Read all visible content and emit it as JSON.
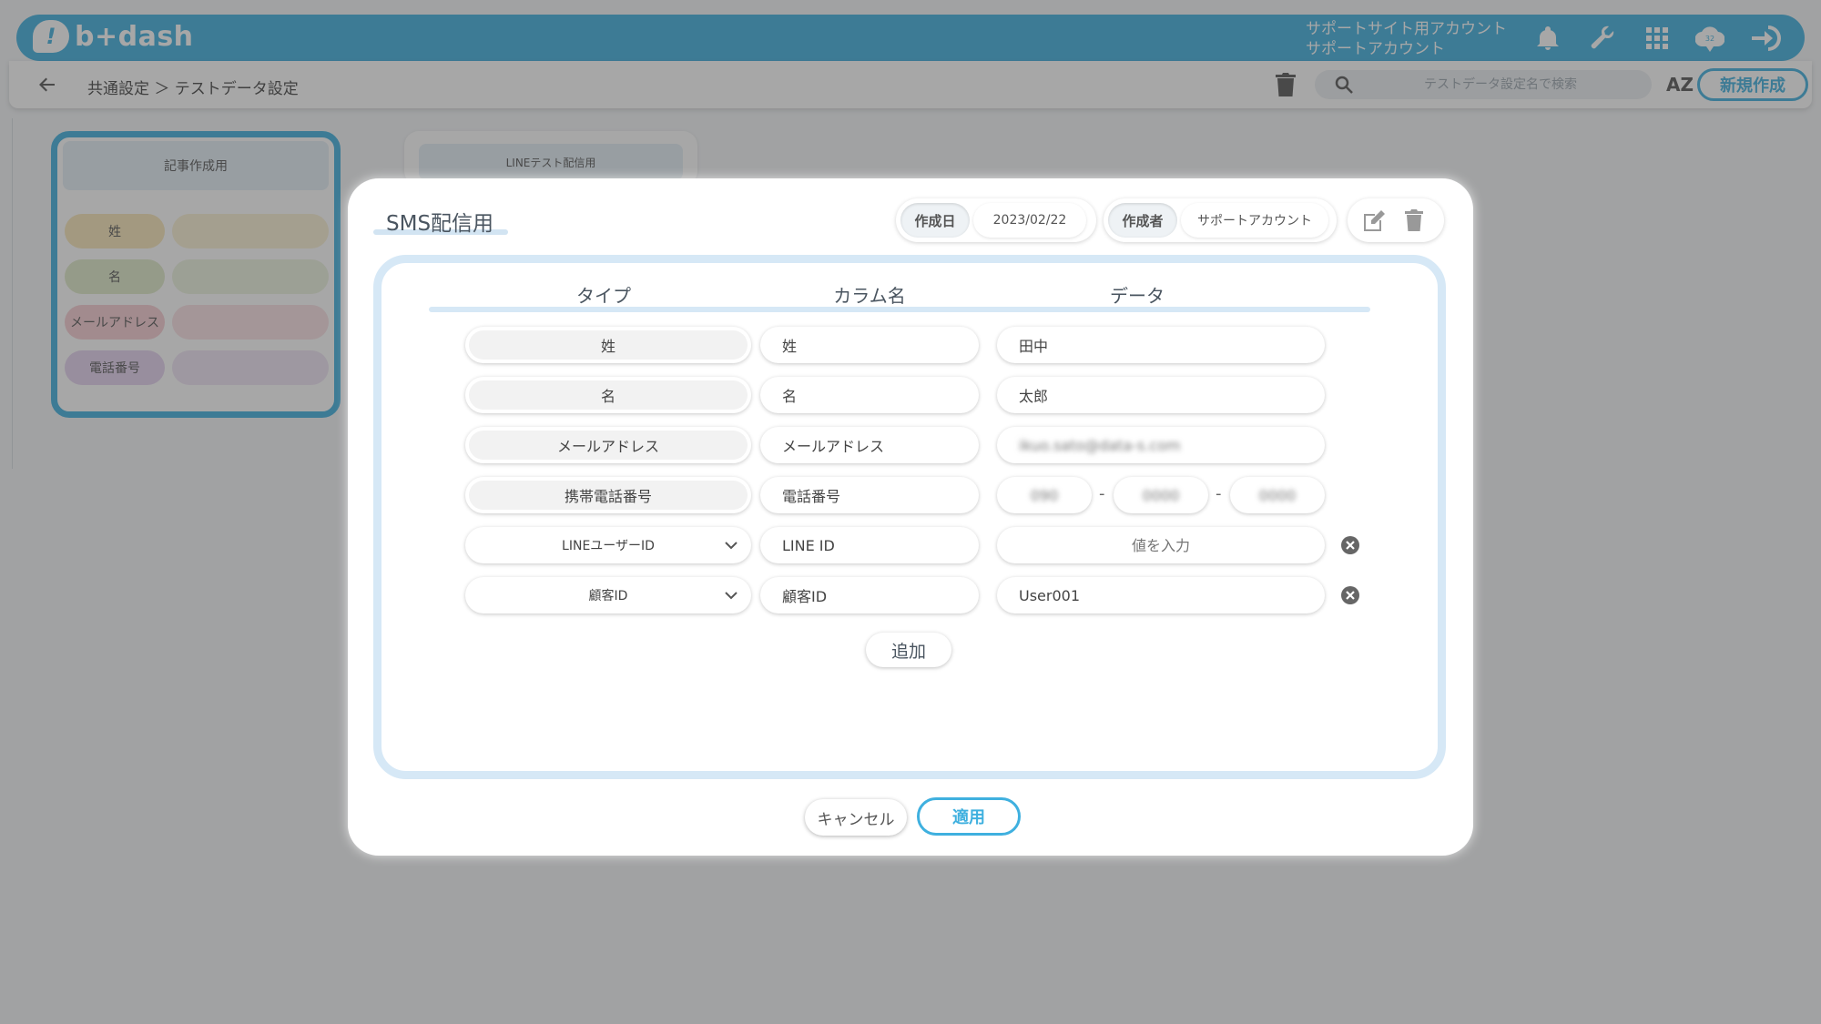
{
  "header": {
    "logo_text": "b+dash",
    "logo_mark": "!",
    "account_line1": "サポートサイト用アカウント",
    "account_line2": "サポートアカウント",
    "icons": [
      "bell-icon",
      "wrench-icon",
      "apps-grid-icon",
      "notification-cloud-icon",
      "logout-icon"
    ],
    "notification_count": "32"
  },
  "subbar": {
    "breadcrumb": "共通設定 ＞ テストデータ設定",
    "search_placeholder": "テストデータ設定名で検索",
    "sort_label": "AZ",
    "new_button": "新規作成"
  },
  "background_cards": [
    {
      "title": "記事作成用",
      "rows": [
        {
          "key": "姓",
          "color": "#f7e6b8"
        },
        {
          "key": "名",
          "color": "#dfe9c8"
        },
        {
          "key": "メールアドレス",
          "color": "#f6cdd2"
        },
        {
          "key": "電話番号",
          "color": "#e4d2ee"
        }
      ]
    },
    {
      "title": "LINEテスト配信用"
    }
  ],
  "modal": {
    "title": "SMS配信用",
    "created_date_label": "作成日",
    "created_date": "2023/02/22",
    "creator_label": "作成者",
    "creator": "サポートアカウント",
    "columns": {
      "type": "タイプ",
      "column_name": "カラム名",
      "data": "データ"
    },
    "rows": [
      {
        "type": "姓",
        "column": "姓",
        "data": "田中"
      },
      {
        "type": "名",
        "column": "名",
        "data": "太郎"
      },
      {
        "type": "メールアドレス",
        "column": "メールアドレス",
        "data": "ikuo.sato@data-s.com"
      },
      {
        "type": "携帯電話番号",
        "column": "電話番号",
        "tel": [
          "090",
          "0000",
          "0000"
        ]
      },
      {
        "type": "LINEユーザーID",
        "column": "LINE ID",
        "placeholder": "値を入力"
      },
      {
        "type": "顧客ID",
        "column": "顧客ID",
        "data": "User001"
      }
    ],
    "add_button": "追加",
    "cancel_button": "キャンセル",
    "apply_button": "適用"
  }
}
